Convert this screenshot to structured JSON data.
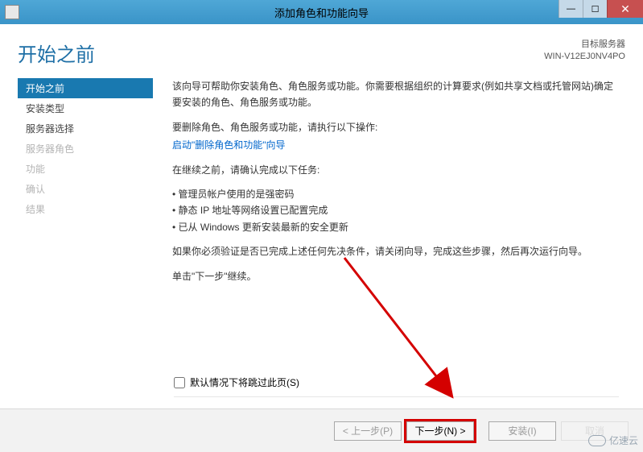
{
  "window": {
    "title": "添加角色和功能向导"
  },
  "header": {
    "page_title": "开始之前",
    "target_label": "目标服务器",
    "target_server": "WIN-V12EJ0NV4PO"
  },
  "sidebar": {
    "items": [
      {
        "label": "开始之前",
        "state": "active"
      },
      {
        "label": "安装类型",
        "state": "normal"
      },
      {
        "label": "服务器选择",
        "state": "normal"
      },
      {
        "label": "服务器角色",
        "state": "disabled"
      },
      {
        "label": "功能",
        "state": "disabled"
      },
      {
        "label": "确认",
        "state": "disabled"
      },
      {
        "label": "结果",
        "state": "disabled"
      }
    ]
  },
  "body": {
    "intro": "该向导可帮助你安装角色、角色服务或功能。你需要根据组织的计算要求(例如共享文档或托管网站)确定要安装的角色、角色服务或功能。",
    "remove_line": "要删除角色、角色服务或功能，请执行以下操作:",
    "remove_link": "启动\"删除角色和功能\"向导",
    "precheck_line": "在继续之前，请确认完成以下任务:",
    "bullets": [
      "管理员帐户使用的是强密码",
      "静态 IP 地址等网络设置已配置完成",
      "已从 Windows 更新安装最新的安全更新"
    ],
    "verify_line": "如果你必须验证是否已完成上述任何先决条件，请关闭向导，完成这些步骤，然后再次运行向导。",
    "continue_line": "单击\"下一步\"继续。",
    "skip_checkbox": "默认情况下将跳过此页(S)"
  },
  "footer": {
    "prev": "< 上一步(P)",
    "next": "下一步(N) >",
    "install": "安装(I)",
    "cancel": "取消"
  },
  "watermark": "亿速云"
}
